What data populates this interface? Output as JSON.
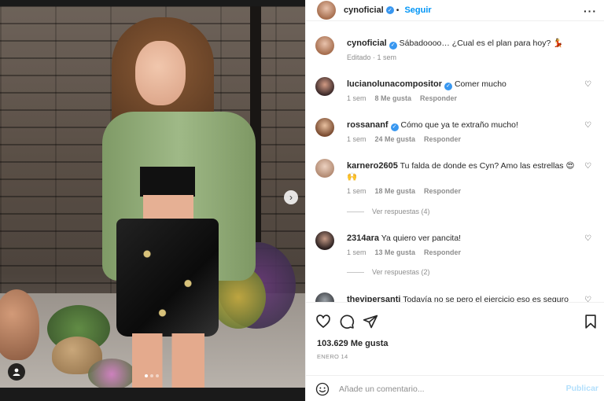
{
  "post": {
    "username": "cynoficial",
    "follow_label": "Seguir",
    "more_icon": "ellipsis-icon",
    "caption": "Sábadoooo… ¿Cual es el plan para hoy? 💃",
    "caption_meta": "Editado · 1 sem",
    "likes": "103.629 Me gusta",
    "date": "ENERO 14"
  },
  "comments": [
    {
      "user": "lucianolunacompositor",
      "verified": true,
      "text": "Comer mucho",
      "time": "1 sem",
      "likes": "8 Me gusta",
      "reply": "Responder"
    },
    {
      "user": "rossananf",
      "verified": true,
      "text": "Cómo que ya te extraño mucho!",
      "time": "1 sem",
      "likes": "24 Me gusta",
      "reply": "Responder"
    },
    {
      "user": "karnero2605",
      "verified": false,
      "text": "Tu falda de donde es Cyn? Amo las estrellas 😍🙌",
      "time": "1 sem",
      "likes": "18 Me gusta",
      "reply": "Responder",
      "view_replies": "Ver respuestas (4)"
    },
    {
      "user": "2314ara",
      "verified": false,
      "text": "Ya quiero ver pancita!",
      "time": "1 sem",
      "likes": "13 Me gusta",
      "reply": "Responder",
      "view_replies": "Ver respuestas (2)"
    },
    {
      "user": "thevipersanti",
      "verified": false,
      "text": "Todavía no se pero el ejercicio eso es seguro"
    }
  ],
  "composer": {
    "placeholder": "Añade un comentario...",
    "publish_label": "Publicar"
  },
  "icons": {
    "like": "heart-icon",
    "comment": "comment-icon",
    "share": "send-icon",
    "save": "bookmark-icon",
    "emoji": "smiley-icon",
    "next": "chevron-right-icon",
    "tag": "user-tag-icon"
  },
  "colors": {
    "accent": "#0095f6",
    "verified": "#3897f0",
    "muted": "#8e8e8e",
    "publish_disabled": "#b2dffc"
  }
}
